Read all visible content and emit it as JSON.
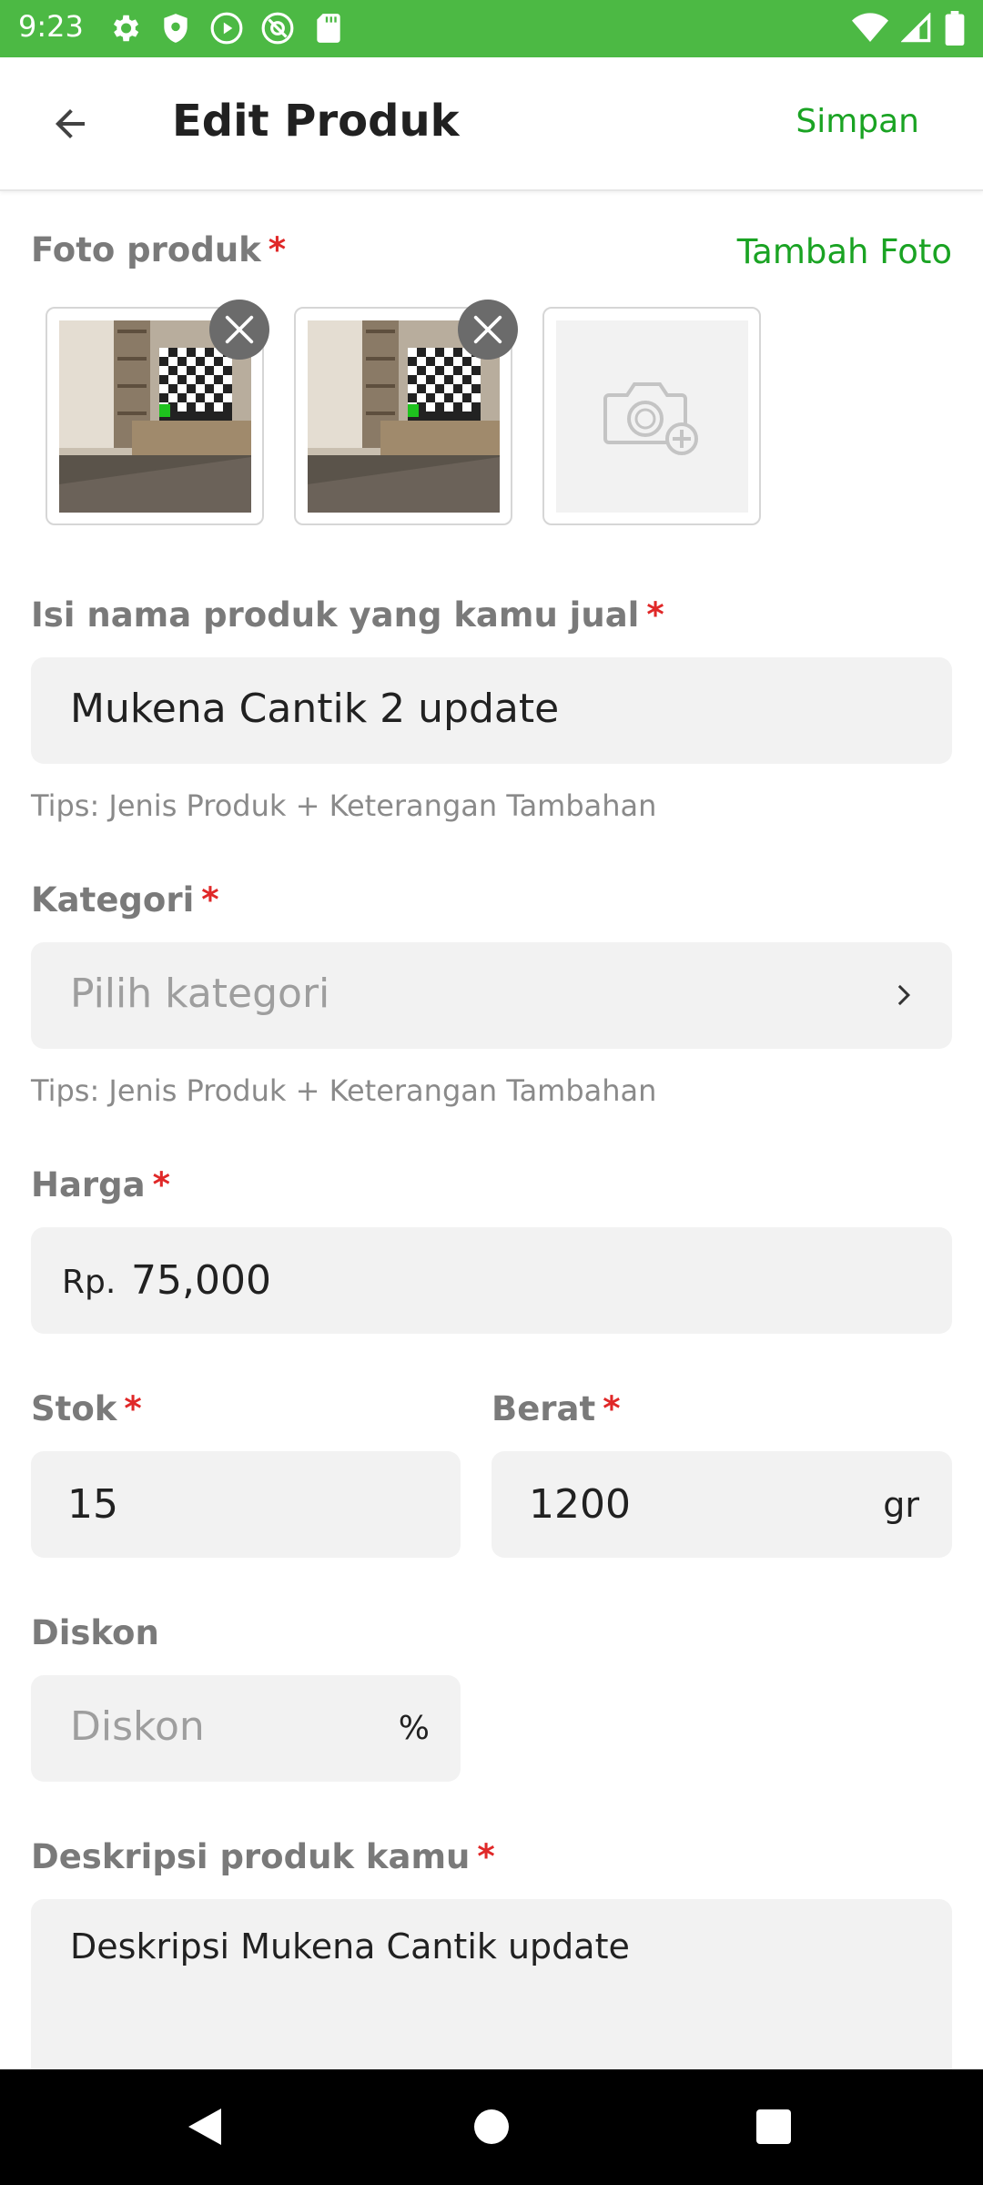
{
  "status_bar": {
    "time": "9:23",
    "background": "#4cb944",
    "left_icons": [
      "settings-icon",
      "shield-icon",
      "play-icon",
      "at-sign-icon",
      "sd-card-icon"
    ],
    "right_icons": [
      "wifi-icon",
      "cell-signal-icon",
      "battery-icon"
    ]
  },
  "app_bar": {
    "title": "Edit Produk",
    "save_label": "Simpan",
    "accent": "#1aa323"
  },
  "photos": {
    "label": "Foto produk",
    "required": "*",
    "add_link": "Tambah Foto",
    "items": [
      {
        "type": "image",
        "icon": "product-photo"
      },
      {
        "type": "image",
        "icon": "product-photo"
      },
      {
        "type": "add",
        "icon": "add-camera-icon"
      }
    ]
  },
  "product_name": {
    "label": "Isi nama produk yang kamu jual",
    "required": "*",
    "value": "Mukena Cantik 2 update",
    "tips": "Tips: Jenis Produk + Keterangan Tambahan"
  },
  "category": {
    "label": "Kategori",
    "required": "*",
    "placeholder": "Pilih kategori",
    "tips": "Tips: Jenis Produk + Keterangan Tambahan"
  },
  "price": {
    "label": "Harga",
    "required": "*",
    "prefix": "Rp.",
    "value": "75,000"
  },
  "stock": {
    "label": "Stok",
    "required": "*",
    "value": "15"
  },
  "weight": {
    "label": "Berat",
    "required": "*",
    "value": "1200",
    "unit": "gr"
  },
  "discount": {
    "label": "Diskon",
    "placeholder": "Diskon",
    "unit": "%"
  },
  "description": {
    "label": "Deskripsi produk kamu",
    "required": "*",
    "value": "Deskripsi Mukena Cantik update"
  },
  "colors": {
    "required": "#e02828",
    "label": "#7a7a7a",
    "field_bg": "#f2f2f2"
  }
}
